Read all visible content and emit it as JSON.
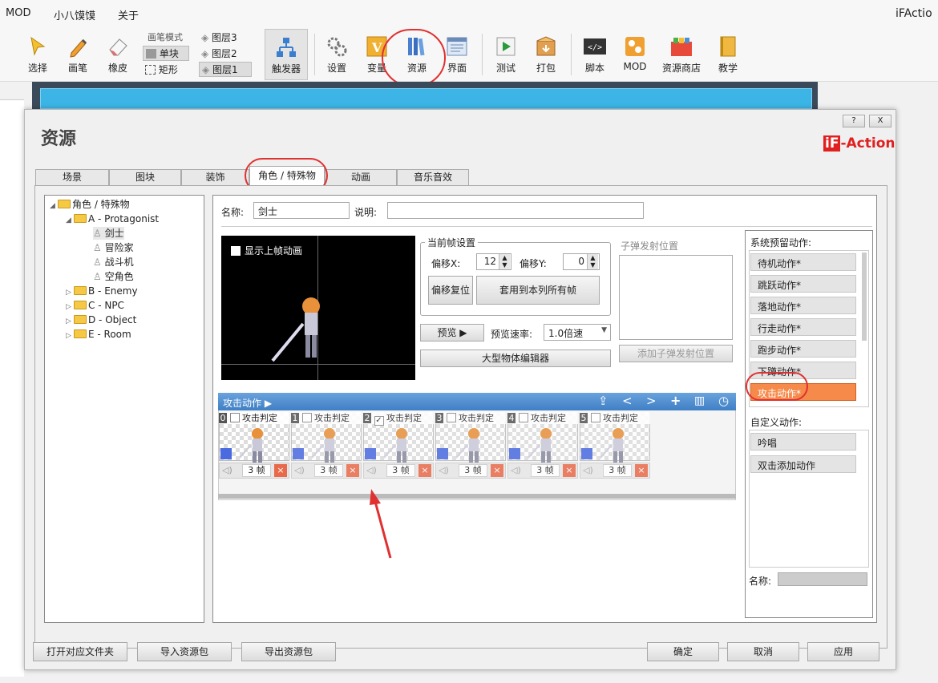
{
  "menu": {
    "items": [
      "MOD",
      "小八馍馍",
      "关于"
    ],
    "app_title": "iFActio"
  },
  "toolbar": {
    "select": "选择",
    "brush": "画笔",
    "eraser": "橡皮",
    "brush_mode": "画笔模式",
    "single": "单块",
    "rect": "矩形",
    "layer3": "图层3",
    "layer2": "图层2",
    "layer1": "图层1",
    "trigger": "触发器",
    "settings": "设置",
    "variable": "变量",
    "resource": "资源",
    "ui": "界面",
    "test": "测试",
    "pack": "打包",
    "script": "脚本",
    "mod": "MOD",
    "store": "资源商店",
    "teach": "教学"
  },
  "dialog": {
    "title": "资源",
    "logo_if": "iF",
    "logo_action": "-Action",
    "help": "?",
    "close": "X"
  },
  "tabs": [
    "场景",
    "图块",
    "装饰",
    "角色 / 特殊物",
    "动画",
    "音乐音效"
  ],
  "tree": {
    "root": "角色 / 特殊物",
    "group_a": "A - Protagonist",
    "a_items": [
      "剑士",
      "冒险家",
      "战斗机",
      "空角色"
    ],
    "groups": [
      "B - Enemy",
      "C - NPC",
      "D - Object",
      "E - Room"
    ]
  },
  "form": {
    "name_label": "名称:",
    "name_value": "剑士",
    "desc_label": "说明:",
    "desc_value": ""
  },
  "preview": {
    "show_prev": "显示上帧动画"
  },
  "frameset": {
    "title": "当前帧设置",
    "offset_x_label": "偏移X:",
    "offset_x": "12",
    "offset_y_label": "偏移Y:",
    "offset_y": "0",
    "reset": "偏移复位",
    "apply_all": "套用到本列所有帧"
  },
  "playback": {
    "preview_btn": "预览 ▶",
    "speed_label": "预览速率:",
    "speed_value": "1.0倍速",
    "big_editor": "大型物体编辑器"
  },
  "bullet": {
    "title": "子弹发射位置",
    "add_btn": "添加子弹发射位置"
  },
  "timeline": {
    "title": "攻击动作 ▶",
    "frames": [
      {
        "idx": "0",
        "label": "攻击判定",
        "checked": false,
        "dur": "3 帧"
      },
      {
        "idx": "1",
        "label": "攻击判定",
        "checked": false,
        "dur": "3 帧"
      },
      {
        "idx": "2",
        "label": "攻击判定",
        "checked": true,
        "dur": "3 帧"
      },
      {
        "idx": "3",
        "label": "攻击判定",
        "checked": false,
        "dur": "3 帧"
      },
      {
        "idx": "4",
        "label": "攻击判定",
        "checked": false,
        "dur": "3 帧"
      },
      {
        "idx": "5",
        "label": "攻击判定",
        "checked": false,
        "dur": "3 帧"
      }
    ]
  },
  "actions": {
    "system_title": "系统预留动作:",
    "system": [
      "待机动作*",
      "跳跃动作*",
      "落地动作*",
      "行走动作*",
      "跑步动作*",
      "下蹲动作*",
      "攻击动作*"
    ],
    "custom_title": "自定义动作:",
    "custom": [
      "吟唱",
      "双击添加动作"
    ],
    "name_label": "名称:"
  },
  "bottom": {
    "open_folder": "打开对应文件夹",
    "import": "导入资源包",
    "export": "导出资源包",
    "ok": "确定",
    "cancel": "取消",
    "apply": "应用"
  },
  "colors": {
    "accent": "#f58a4a",
    "highlight": "#e03030",
    "timeline": "#4a8bcf"
  }
}
